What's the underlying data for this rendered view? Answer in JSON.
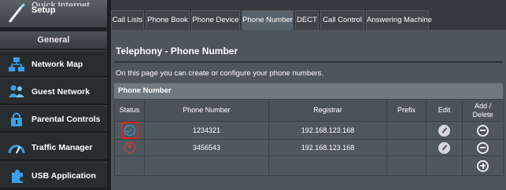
{
  "sidebar": {
    "setup_label_top": "Quick Internet",
    "setup_label": "Setup",
    "section_header": "General",
    "items": [
      {
        "label": "Network Map",
        "icon": "network-map-icon"
      },
      {
        "label": "Guest Network",
        "icon": "guest-network-icon"
      },
      {
        "label": "Parental Controls",
        "icon": "parental-controls-icon"
      },
      {
        "label": "Traffic Manager",
        "icon": "traffic-manager-icon"
      },
      {
        "label": "USB Application",
        "icon": "usb-application-icon"
      }
    ]
  },
  "tabs": [
    "Call Lists",
    "Phone Book",
    "Phone Device",
    "Phone Number",
    "DECT",
    "Call Control",
    "Answering Machine"
  ],
  "active_tab": "Phone Number",
  "page": {
    "title": "Telephony - Phone Number",
    "description": "On this page you can create or configure your phone numbers."
  },
  "table": {
    "caption": "Phone Number",
    "headers": {
      "status": "Status",
      "phone_number": "Phone Number",
      "registrar": "Registrar",
      "prefix": "Prefix",
      "edit": "Edit",
      "add_delete_1": "Add /",
      "add_delete_2": "Delete"
    },
    "rows": [
      {
        "status": "registered",
        "phone_number": "1234321",
        "registrar": "192.168.123.168",
        "prefix": ""
      },
      {
        "status": "failed",
        "phone_number": "3456543",
        "registrar": "192.168.123.168",
        "prefix": ""
      }
    ]
  },
  "colors": {
    "status_ok": "#33a3e6",
    "status_error": "#e03a3a",
    "highlight": "#e02222"
  }
}
